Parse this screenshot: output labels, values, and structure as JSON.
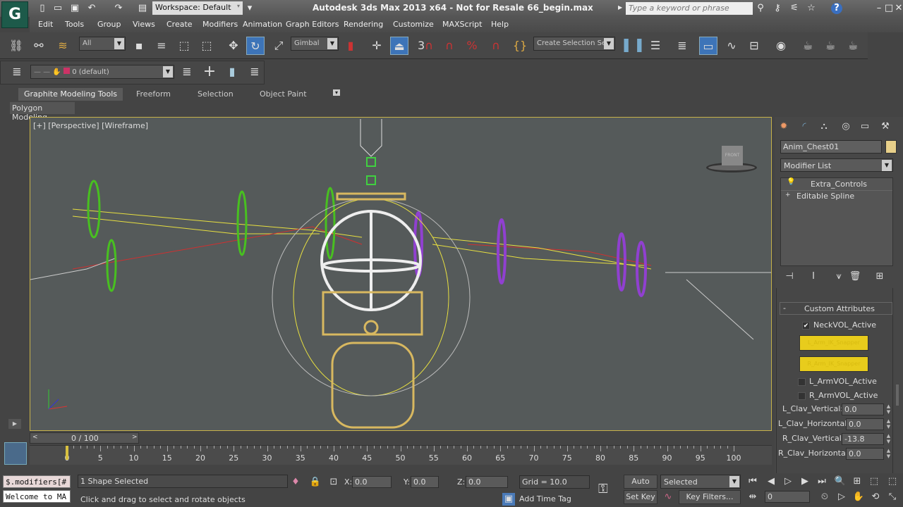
{
  "title_bar": {
    "workspace": "Workspace: Default",
    "title": "Autodesk 3ds Max  2013 x64  - Not for Resale   66_begin.max",
    "search_placeholder": "Type a keyword or phrase",
    "app_logo": "3ds Max logo"
  },
  "menu": [
    "Edit",
    "Tools",
    "Group",
    "Views",
    "Create",
    "Modifiers",
    "Animation",
    "Graph Editors",
    "Rendering",
    "Customize",
    "MAXScript",
    "Help"
  ],
  "toolbar": {
    "selection_filter": "All",
    "ref_coord": "Gimbal",
    "snap_angle_label": "3",
    "selection_set": "Create Selection Se"
  },
  "layer_bar": {
    "current_layer": "0 (default)",
    "layer_color": "#cc3366"
  },
  "ribbon": {
    "tabs": [
      "Graphite Modeling Tools",
      "Freeform",
      "Selection",
      "Object Paint"
    ],
    "active_tab": "Graphite Modeling Tools",
    "panel": "Polygon Modeling"
  },
  "viewport": {
    "label": "[+] [Perspective] [Wireframe]",
    "viewcube": "FRONT",
    "border_color": "#c8b24a"
  },
  "command_panel": {
    "object_name": "Anim_Chest01",
    "object_color": "#e8d08a",
    "modifier_list": "Modifier List",
    "stack": [
      "Extra_Controls",
      "Editable Spline"
    ],
    "rollout_title": "Custom Attributes",
    "neck_vol": {
      "label": "NeckVOL_Active",
      "checked": true
    },
    "yellow_buttons": [
      "L_Arm_IK_Snapper",
      "R_Arm_IK_Snapper"
    ],
    "l_arm_vol": {
      "label": "L_ArmVOL_Active",
      "checked": false
    },
    "r_arm_vol": {
      "label": "R_ArmVOL_Active",
      "checked": false
    },
    "spinners": [
      {
        "label": "L_Clav_Vertical:",
        "value": "0.0"
      },
      {
        "label": "L_Clav_Horizontal:",
        "value": "0.0"
      },
      {
        "label": "R_Clav_Vertical:",
        "value": "-13.8"
      },
      {
        "label": "R_Clav_Horizontal:",
        "value": "0.0"
      }
    ]
  },
  "timeline": {
    "frame": "0 / 100",
    "ticks": [
      "0",
      "5",
      "10",
      "15",
      "20",
      "25",
      "30",
      "35",
      "40",
      "45",
      "50",
      "55",
      "60",
      "65",
      "70",
      "75",
      "80",
      "85",
      "90",
      "95",
      "100"
    ],
    "current_frame": 0
  },
  "status": {
    "maxscript_line1": "$.modifiers[#",
    "maxscript_line2": "Welcome to MA",
    "selection": "1 Shape Selected",
    "prompt": "Click and drag to select and rotate objects",
    "x_label": "X:",
    "x": "0.0",
    "y_label": "Y:",
    "y": "0.0",
    "z_label": "Z:",
    "z": "0.0",
    "grid": "Grid = 10.0",
    "add_time_tag": "Add Time Tag",
    "auto_key": "Auto Key",
    "set_key": "Set Key",
    "key_mode": "Selected",
    "key_filters": "Key Filters...",
    "frame_value": "0"
  }
}
